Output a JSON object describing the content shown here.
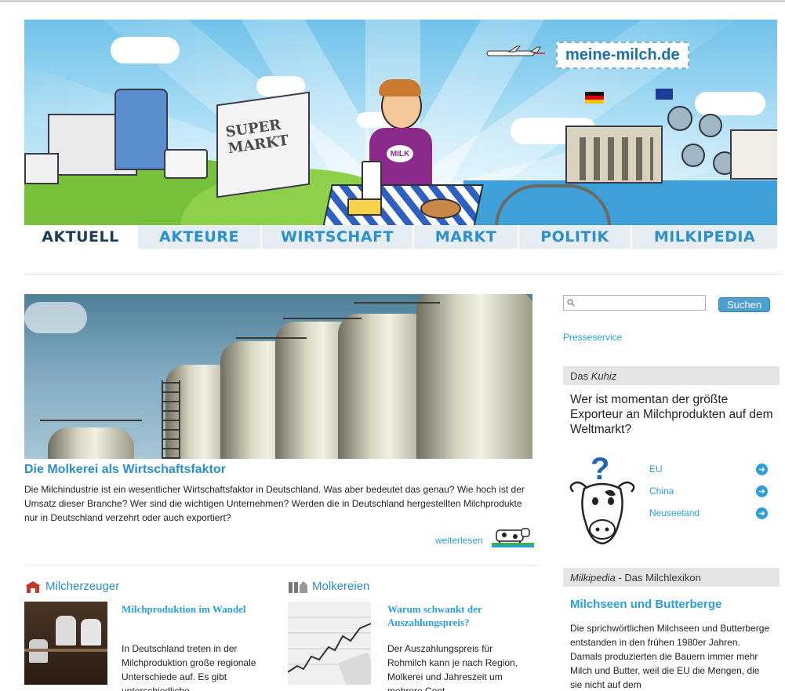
{
  "banner": {
    "logo_text": "meine-milch.de"
  },
  "nav": {
    "tabs": [
      "AKTUELL",
      "AKTEURE",
      "WIRTSCHAFT",
      "MARKT",
      "POLITIK",
      "MILKIPEDIA"
    ],
    "active": "AKTUELL"
  },
  "hero": {
    "title": "Die Molkerei als Wirtschaftsfaktor",
    "text": "Die Milchindustrie ist ein wesentlicher Wirtschaftsfaktor in Deutschland. Was aber bedeutet das genau? Wie hoch ist der Umsatz dieser Branche? Wer sind die wichtigen Unternehmen? Werden die in Deutschland hergestellten Milchprodukte nur in Deutschland verzehrt oder auch exportiert?",
    "read_more": "weiterlesen"
  },
  "sections": {
    "milcherzeuger": {
      "heading": "Milcherzeuger",
      "teaser_title": "Milchproduktion im Wandel",
      "teaser_text": "In Deutschland treten in der Milchproduktion große regionale Unterschiede auf. Es gibt unterschiedliche"
    },
    "molkereien": {
      "heading": "Molkereien",
      "teaser_title": "Warum schwankt der Auszahlungspreis?",
      "teaser_text": "Der Auszahlungspreis für Rohmilch kann je nach Region, Molkerei und Jahreszeit um mehrere Cent"
    }
  },
  "sidebar": {
    "search_placeholder": "",
    "search_button": "Suchen",
    "presseservice": "Presseservice",
    "quiz": {
      "header_prefix": "Das ",
      "header_em": "Kuhiz",
      "question": "Wer ist momentan der größte Exporteur an Milchprodukten auf dem Weltmarkt?",
      "answers": [
        "EU",
        "China",
        "Neuseeland"
      ]
    },
    "lexikon": {
      "header_em": "Milkipedia",
      "header_rest": " - Das Milchlexikon",
      "title": "Milchseen und Butterberge",
      "text": "Die sprichwörtlichen Milchseen und Butterberge entstanden in den frühen 1980er Jahren. Damals produzierten die Bauern immer mehr Milch und Butter, weil die EU die Mengen, die sie nicht auf dem"
    }
  }
}
